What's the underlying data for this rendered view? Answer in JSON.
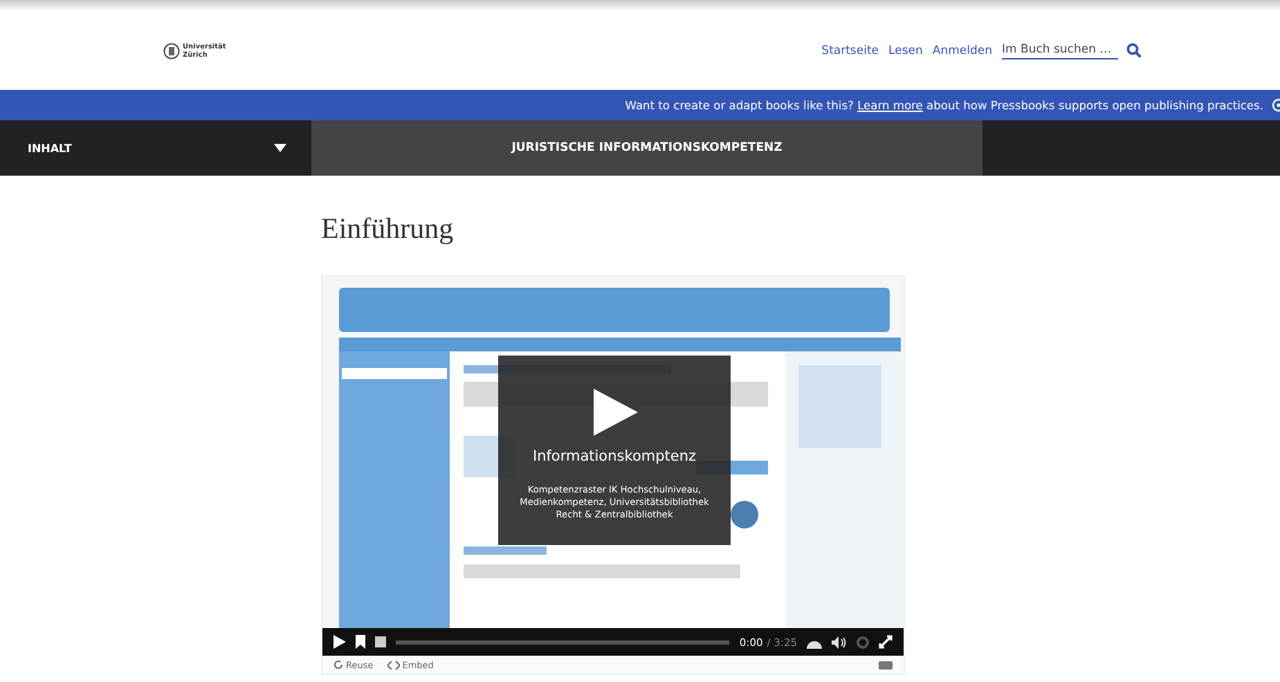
{
  "header": {
    "logo": {
      "line_1": "Universität",
      "line_2": "Zürich"
    },
    "nav": [
      {
        "label": "Startseite"
      },
      {
        "label": "Lesen"
      },
      {
        "label": "Anmelden"
      }
    ],
    "search": {
      "placeholder": "Im Buch suchen …"
    }
  },
  "banner": {
    "before": "Want to create or adapt books like this?",
    "link": "Learn more",
    "after": "about how Pressbooks supports open publishing practices."
  },
  "navbar": {
    "toc_label": "INHALT",
    "book_title": "JURISTISCHE INFORMATIONSKOMPETENZ"
  },
  "chapter": {
    "title": "Einführung",
    "video": {
      "kind": "picture",
      "title": "Informationskomptenz",
      "description": "Kompetenzraster IK Hochschulniveau, Medienkompetenz, Universitätsbibliothek Recht & Zentralbibliothek",
      "time_current": "0:00",
      "time_total": "/ 3:25",
      "reuse": "Reuse",
      "embed": "Embed"
    }
  }
}
